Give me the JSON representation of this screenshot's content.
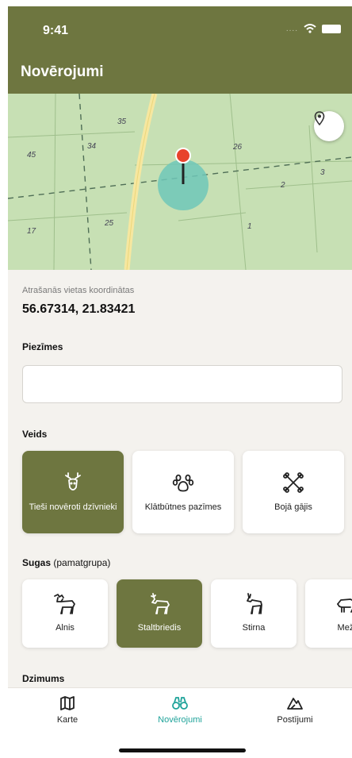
{
  "status": {
    "time": "9:41"
  },
  "header": {
    "title": "Novērojumi"
  },
  "map": {
    "parcel_numbers": [
      "35",
      "45",
      "34",
      "26",
      "2",
      "3",
      "17",
      "25",
      "1"
    ]
  },
  "location": {
    "label": "Atrašanās vietas koordinātas",
    "value": "56.67314, 21.83421"
  },
  "notes": {
    "label": "Piezīmes",
    "value": "",
    "placeholder": ""
  },
  "type": {
    "label": "Veids",
    "options": [
      {
        "label": "Tieši novēroti dzīvnieki",
        "icon": "deer-head-icon",
        "selected": true
      },
      {
        "label": "Klātbūtnes pazīmes",
        "icon": "paw-print-icon",
        "selected": false
      },
      {
        "label": "Bojā gājis",
        "icon": "bones-icon",
        "selected": false
      }
    ]
  },
  "species": {
    "label": "Sugas",
    "sublabel": "(pamatgrupa)",
    "options": [
      {
        "label": "Alnis",
        "icon": "moose-icon",
        "selected": false
      },
      {
        "label": "Staltbriedis",
        "icon": "red-deer-icon",
        "selected": true
      },
      {
        "label": "Stirna",
        "icon": "roe-deer-icon",
        "selected": false
      },
      {
        "label": "Meža",
        "icon": "boar-icon",
        "selected": false
      }
    ]
  },
  "gender": {
    "label": "Dzimums"
  },
  "tabs": [
    {
      "label": "Karte",
      "icon": "map-icon",
      "active": false
    },
    {
      "label": "Novērojumi",
      "icon": "binoculars-icon",
      "active": true
    },
    {
      "label": "Postījumi",
      "icon": "damage-icon",
      "active": false
    }
  ],
  "colors": {
    "primary": "#6e7640",
    "accent": "#1fa39a",
    "pin": "#e8432c",
    "map": "#c7e0b4"
  }
}
